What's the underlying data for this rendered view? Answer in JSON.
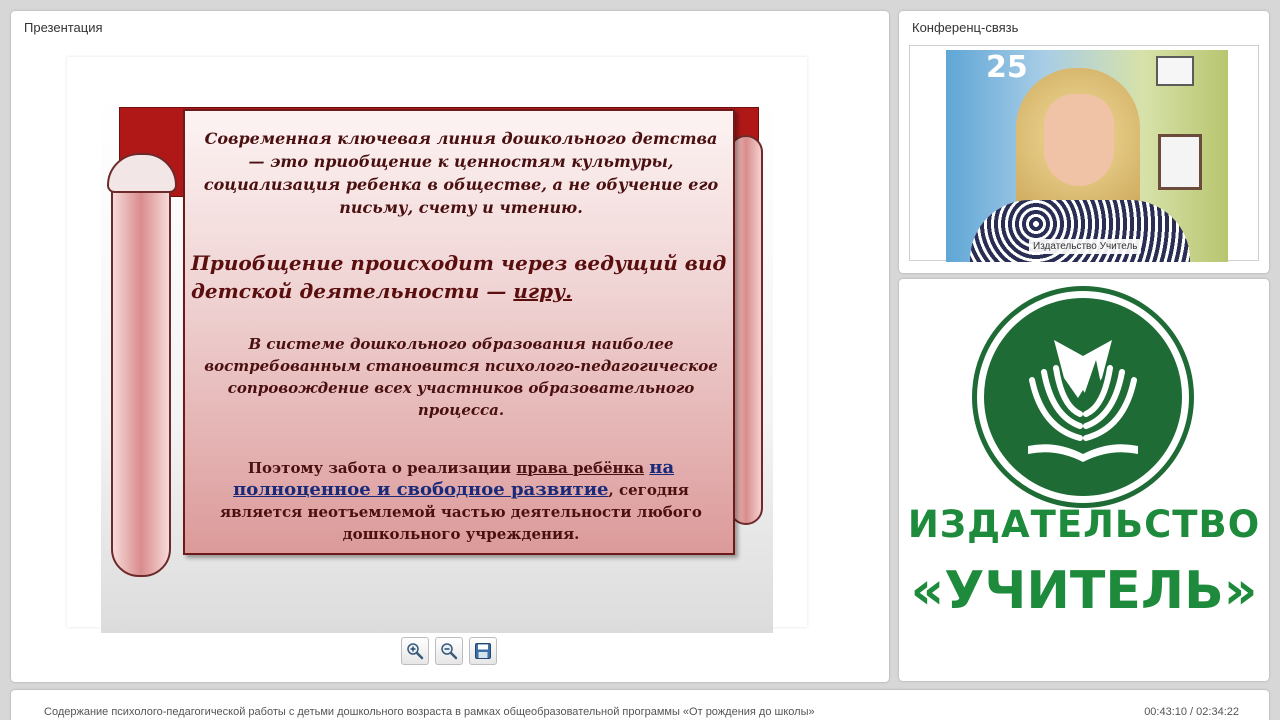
{
  "presentation": {
    "title": "Презентация",
    "slide": {
      "paragraph1": "Современная ключевая линия дошкольного детства — это приобщение к ценностям культуры, социализация ребенка в обществе, а не обучение его письму, счету и чтению.",
      "paragraph2_part1": "Приобщение происходит через ведущий вид детской деятельности — ",
      "paragraph2_underlined": "игру.",
      "paragraph3": "В системе дошкольного образования наиболее востребованным становится психолого-педагогическое сопровождение всех участников образовательного процесса.",
      "paragraph4_part1": "Поэтому забота о реализации ",
      "paragraph4_link1": "права ребёнка",
      "paragraph4_link2": "на полноценное и свободное развитие",
      "paragraph4_part2": ", сегодня является неотъемлемой частью деятельности любого дошкольного учреждения."
    },
    "toolbar": {
      "zoom_in_icon": "zoom-in-icon",
      "zoom_out_icon": "zoom-out-icon",
      "save_icon": "save-icon"
    }
  },
  "conference": {
    "title": "Конференц-связь",
    "speaker_label": "Издательство Учитель",
    "sign_text": "25"
  },
  "logo": {
    "line1": "ИЗДАТЕЛЬСТВО",
    "line2": "«УЧИТЕЛЬ»",
    "color": "#1e8a3c"
  },
  "footer": {
    "title": "Содержание психолого-педагогической работы с детьми дошкольного возраста в рамках общеобразовательной программы «От рождения до школы»",
    "time": "00:43:10 / 02:34:22"
  }
}
